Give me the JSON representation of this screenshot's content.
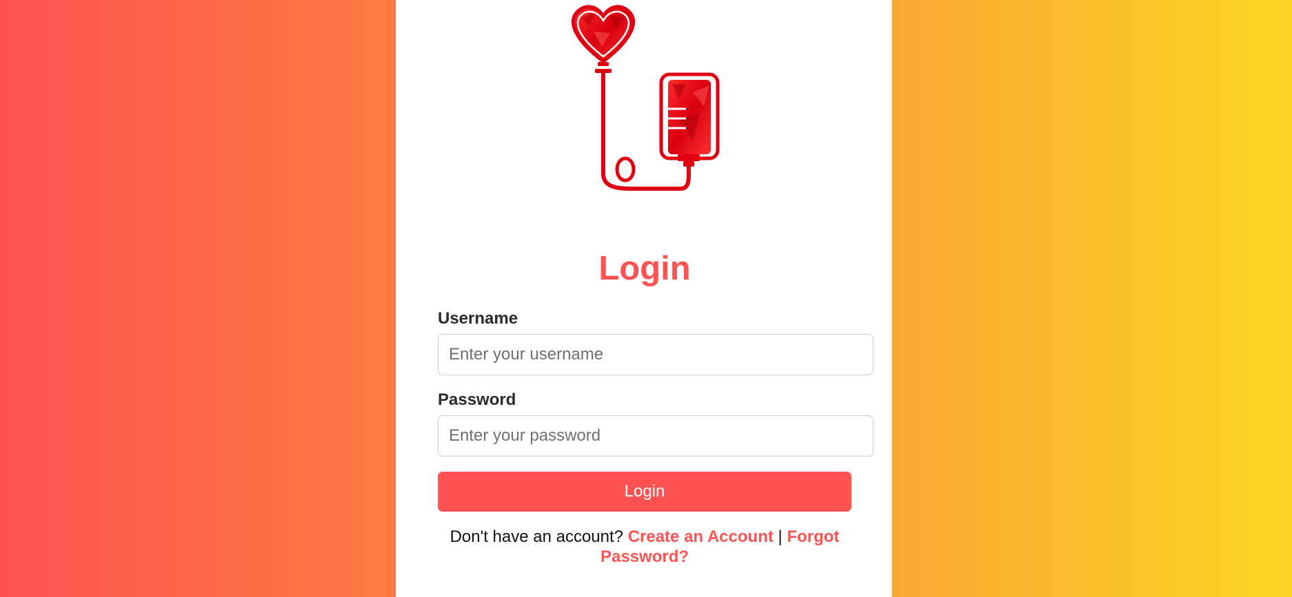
{
  "logo": {
    "icon": "blood-donation-icon",
    "color": "#e00012"
  },
  "login": {
    "title": "Login",
    "username_label": "Username",
    "username_placeholder": "Enter your username",
    "password_label": "Password",
    "password_placeholder": "Enter your password",
    "submit_label": "Login",
    "footer_prefix": "Don't have an account?",
    "create_account_label": "Create an Account",
    "separator": "|",
    "forgot_password_label": "Forgot Password?"
  },
  "colors": {
    "accent": "#ff5252",
    "gradient_start": "#ff5252",
    "gradient_end": "#fad623",
    "card": "#ffffff"
  }
}
